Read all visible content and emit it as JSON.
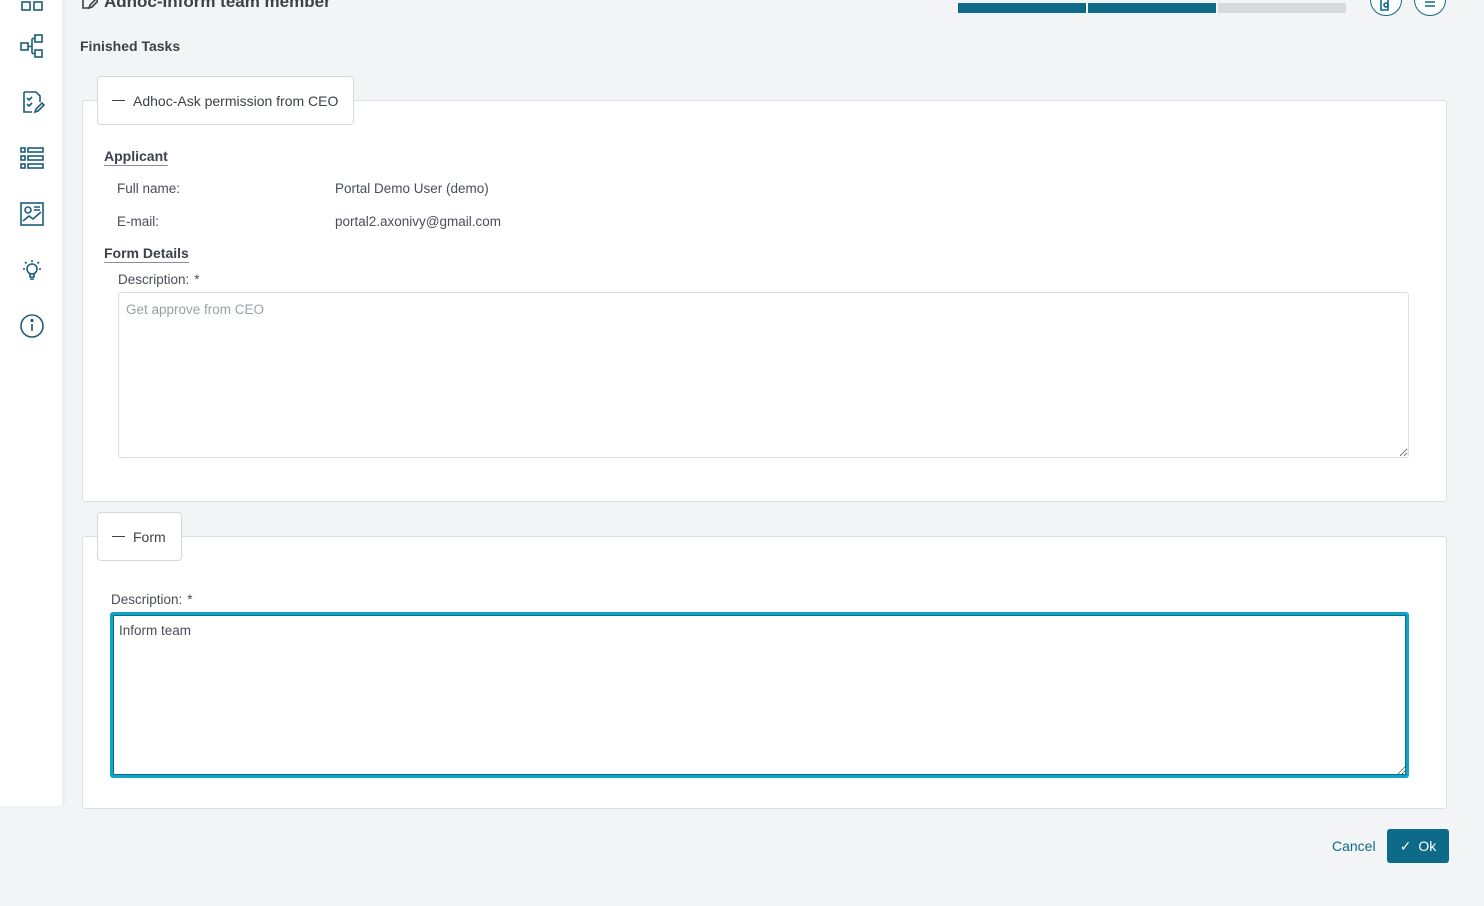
{
  "header": {
    "title": "Adhoc-Inform team member",
    "progress": {
      "completed_steps": 2,
      "total_steps": 3
    }
  },
  "sidebar": {
    "items": [
      {
        "icon": "process-icon"
      },
      {
        "icon": "task-list-icon"
      },
      {
        "icon": "case-list-icon"
      },
      {
        "icon": "statistics-icon"
      },
      {
        "icon": "idea-bulb-icon"
      },
      {
        "icon": "info-icon"
      }
    ]
  },
  "finished_tasks": {
    "title": "Finished Tasks",
    "panel": {
      "legend": "Adhoc-Ask permission from CEO",
      "applicant_heading": "Applicant",
      "full_name_label": "Full name:",
      "full_name_value": "Portal Demo User (demo)",
      "email_label": "E-mail:",
      "email_value": "portal2.axonivy@gmail.com",
      "form_details_heading": "Form Details",
      "description_label": "Description:",
      "required_mark": "*",
      "description_value": "Get approve from CEO"
    }
  },
  "form": {
    "legend": "Form",
    "description_label": "Description:",
    "required_mark": "*",
    "description_value": "Inform team"
  },
  "actions": {
    "cancel_label": "Cancel",
    "ok_label": "Ok"
  },
  "colors": {
    "accent": "#0e6a89",
    "focus": "#0ea5c9",
    "background": "#f3f4f6"
  }
}
